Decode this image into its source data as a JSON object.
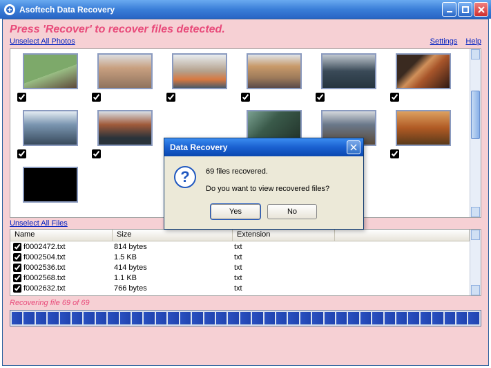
{
  "window": {
    "title": "Asoftech Data Recovery"
  },
  "instruction": "Press 'Recover' to recover files detected.",
  "links": {
    "unselect_photos": "Unselect All Photos",
    "settings": "Settings",
    "help": "Help",
    "unselect_files": "Unselect All Files"
  },
  "file_table": {
    "headers": {
      "name": "Name",
      "size": "Size",
      "ext": "Extension"
    },
    "rows": [
      {
        "name": "f0002472.txt",
        "size": "814 bytes",
        "ext": "txt"
      },
      {
        "name": "f0002504.txt",
        "size": "1.5 KB",
        "ext": "txt"
      },
      {
        "name": "f0002536.txt",
        "size": "414 bytes",
        "ext": "txt"
      },
      {
        "name": "f0002568.txt",
        "size": "1.1 KB",
        "ext": "txt"
      },
      {
        "name": "f0002632.txt",
        "size": "766 bytes",
        "ext": "txt"
      }
    ]
  },
  "status": "Recovering file 69 of 69",
  "dialog": {
    "title": "Data Recovery",
    "line1": "69 files recovered.",
    "line2": "Do you want to view recovered files?",
    "yes": "Yes",
    "no": "No"
  }
}
